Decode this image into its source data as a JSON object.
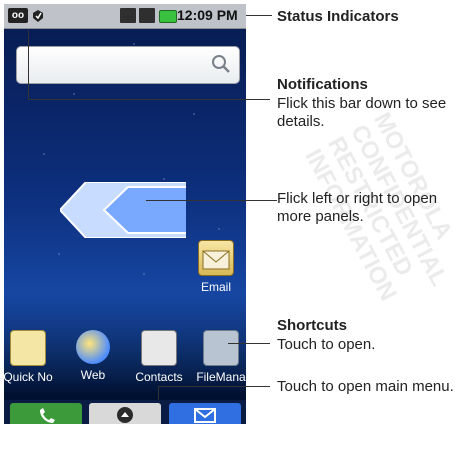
{
  "status_bar": {
    "time": "12:09 PM"
  },
  "home": {
    "apps": {
      "email": "Email",
      "shortcuts": [
        "Quick No",
        "Web",
        "Contacts",
        "FileMana"
      ]
    }
  },
  "annotations": {
    "status_indicators": "Status Indicators",
    "notifications_title": "Notifications",
    "notifications_body": "Flick this bar down to see details.",
    "panels_body": "Flick left or right to open more panels.",
    "shortcuts_title": "Shortcuts",
    "shortcuts_body": "Touch to open.",
    "menu_body": "Touch to open main menu."
  },
  "watermark": "MOTOROLA CONFIDENTIAL RESTRICTED INFORMATION",
  "colors": {
    "accent_green": "#3c9a3a",
    "accent_blue": "#2f6fe1"
  },
  "icons": [
    "voicemail-icon",
    "alert-icon",
    "signal-icon",
    "battery-icon",
    "search-icon",
    "panel-arrow-icon",
    "email-icon",
    "phone-icon",
    "menu-icon",
    "mail-icon"
  ]
}
